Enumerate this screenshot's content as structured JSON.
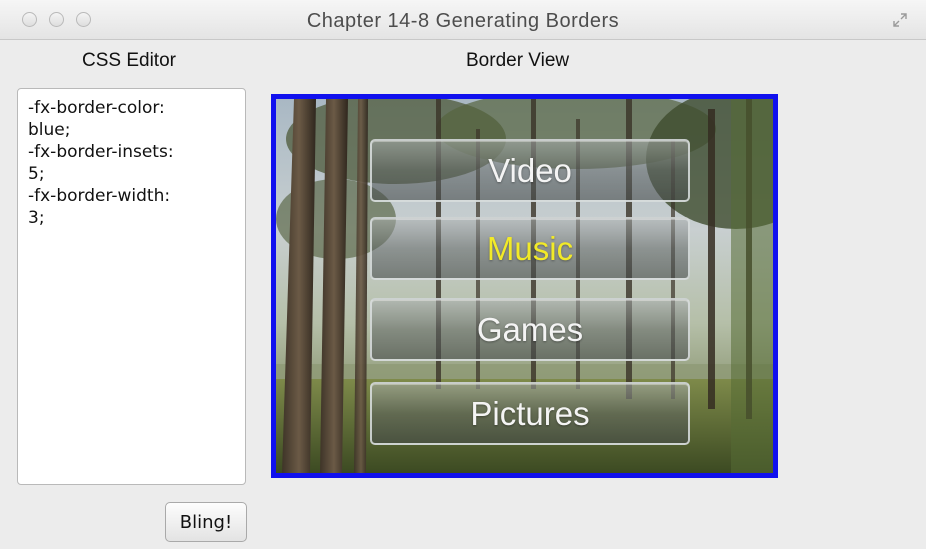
{
  "window": {
    "title": "Chapter 14-8 Generating Borders"
  },
  "editor_panel": {
    "label": "CSS Editor",
    "content": "-fx-border-color:\nblue;\n-fx-border-insets:\n5;\n-fx-border-width:\n3;"
  },
  "bling_button": {
    "label": "Bling!"
  },
  "border_view": {
    "label": "Border View",
    "border_color": "#1010ee",
    "menu": [
      {
        "label": "Video",
        "active": false
      },
      {
        "label": "Music",
        "active": true,
        "color": "#f2ea28"
      },
      {
        "label": "Games",
        "active": false
      },
      {
        "label": "Pictures",
        "active": false
      }
    ]
  },
  "icons": {
    "window_controls": [
      "close-icon",
      "minimize-icon",
      "zoom-icon"
    ],
    "fullscreen": "fullscreen-icon"
  }
}
